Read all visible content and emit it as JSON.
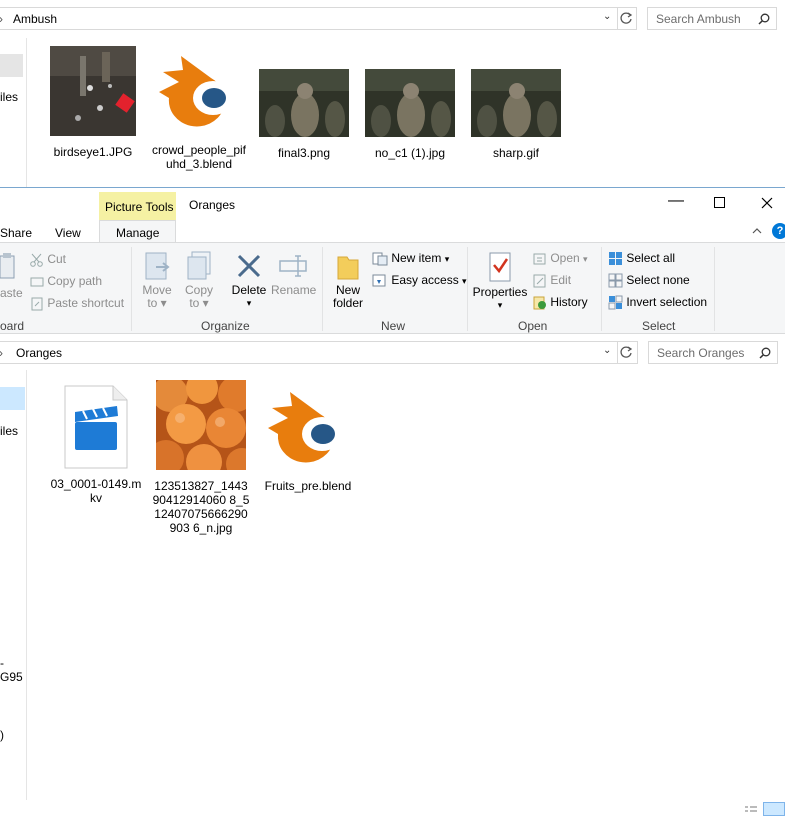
{
  "back_window": {
    "address": "Ambush",
    "search_placeholder": "Search Ambush",
    "nav_fragment": "iles",
    "files": [
      {
        "name": "birdseye1.JPG"
      },
      {
        "name": "crowd_people_pifuhd_3.blend"
      },
      {
        "name": "final3.png"
      },
      {
        "name": "no_c1 (1).jpg"
      },
      {
        "name": "sharp.gif"
      }
    ]
  },
  "front_window": {
    "context_tab": "Picture Tools",
    "title": "Oranges",
    "tabs": [
      "Share",
      "View",
      "Manage"
    ],
    "ribbon": {
      "clipboard": {
        "paste": "aste",
        "cut": "Cut",
        "copy_path": "Copy path",
        "paste_shortcut": "Paste shortcut",
        "label": "oard"
      },
      "organize": {
        "move_to": "Move",
        "move_to2": "to",
        "copy_to": "Copy",
        "copy_to2": "to",
        "delete": "Delete",
        "rename": "Rename",
        "label": "Organize"
      },
      "new": {
        "new_folder": "New",
        "new_folder2": "folder",
        "new_item": "New item",
        "easy_access": "Easy access",
        "label": "New"
      },
      "open": {
        "properties": "Properties",
        "open": "Open",
        "edit": "Edit",
        "history": "History",
        "label": "Open"
      },
      "select": {
        "select_all": "Select all",
        "select_none": "Select none",
        "invert_selection": "Invert selection",
        "label": "Select"
      }
    },
    "address": "Oranges",
    "search_placeholder": "Search Oranges",
    "nav_fragments": [
      "iles",
      "-G95",
      ")"
    ],
    "files": [
      {
        "name": "03_0001-0149.mkv"
      },
      {
        "name": "123513827_144390412914060 8_512407075666290903 6_n.jpg"
      },
      {
        "name": "Fruits_pre.blend"
      }
    ]
  },
  "colors": {
    "accent_blue": "#0078d7",
    "context_tab_yellow": "#f5f1a3",
    "blender_orange": "#e87d0d",
    "blender_blue": "#265787"
  }
}
